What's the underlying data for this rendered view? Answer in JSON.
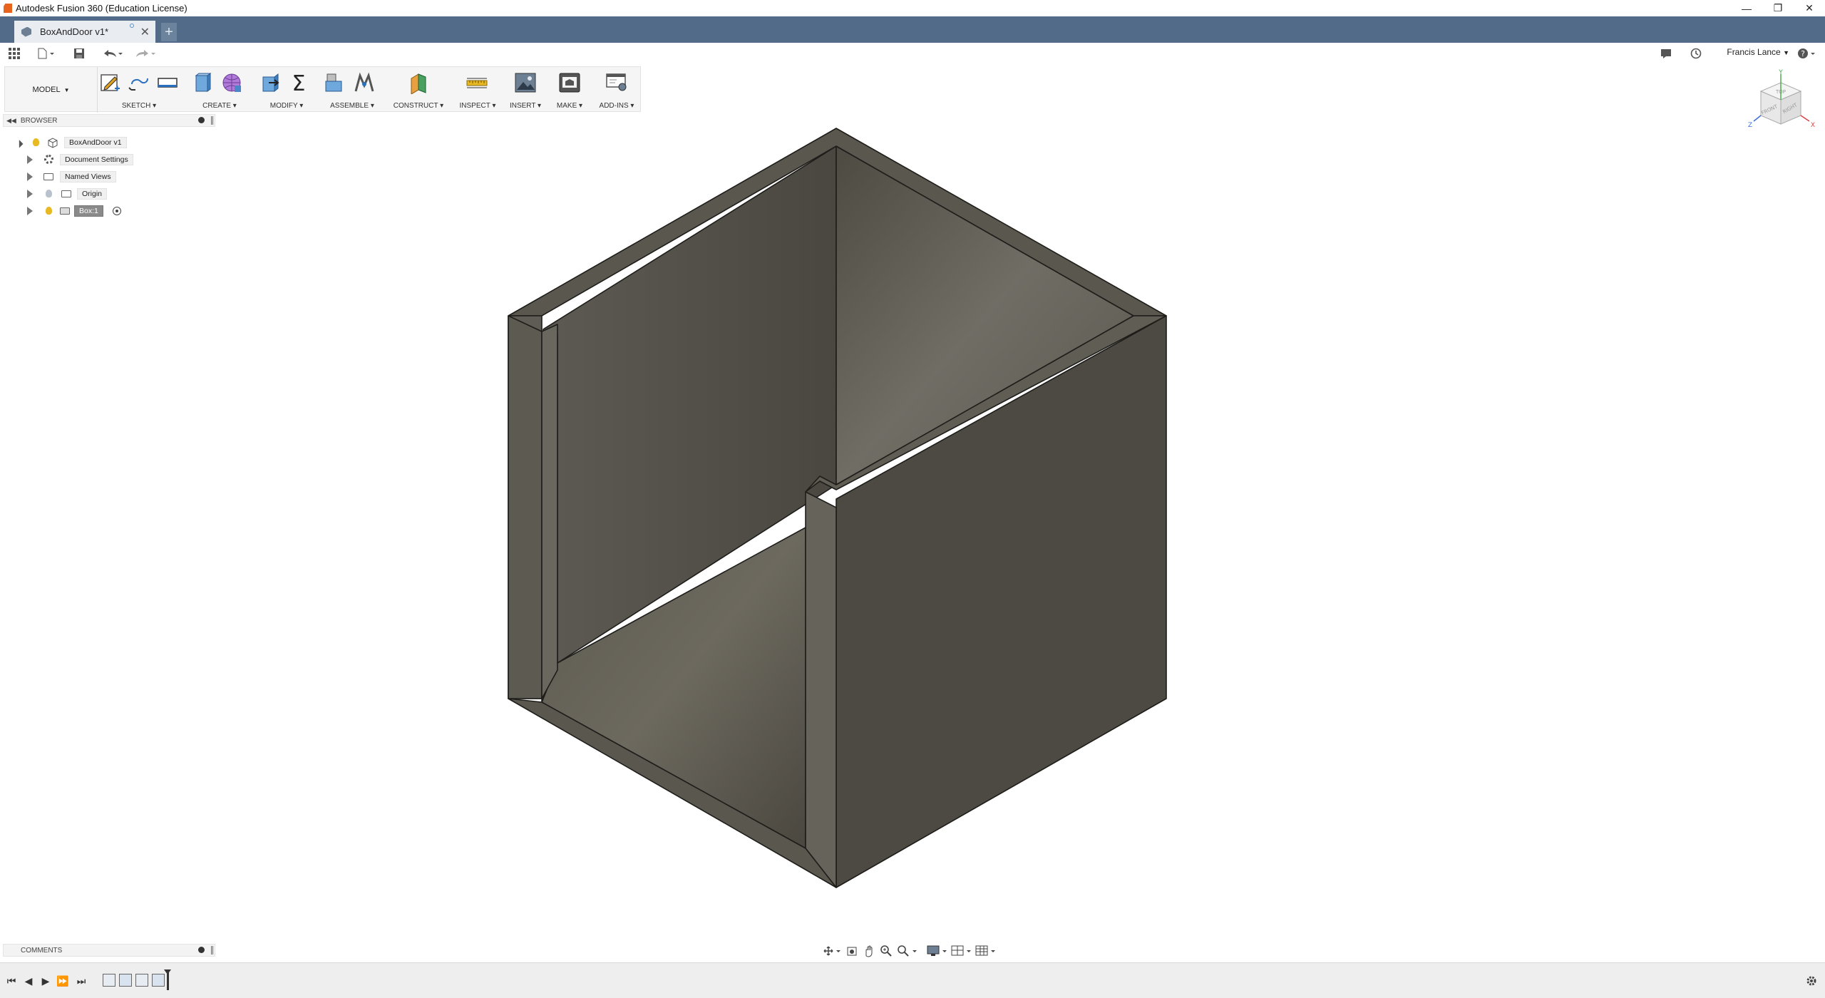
{
  "window": {
    "title": "Autodesk Fusion 360 (Education License)",
    "controls": [
      "minimize",
      "restore",
      "close"
    ]
  },
  "tabs": {
    "active": "BoxAndDoor v1*",
    "new_tab": "+"
  },
  "quick_access": {
    "user": "Francis Lance",
    "help": "?"
  },
  "toolbar": {
    "workspace": "MODEL",
    "groups": [
      {
        "label": "SKETCH",
        "icons": [
          "create-sketch-icon",
          "line-icon",
          "rectangle-icon"
        ]
      },
      {
        "label": "CREATE",
        "icons": [
          "box-icon",
          "form-icon"
        ]
      },
      {
        "label": "MODIFY",
        "icons": [
          "press-pull-icon",
          "parameters-icon"
        ]
      },
      {
        "label": "ASSEMBLE",
        "icons": [
          "new-component-icon",
          "joint-icon"
        ]
      },
      {
        "label": "CONSTRUCT",
        "icons": [
          "offset-plane-icon"
        ]
      },
      {
        "label": "INSPECT",
        "icons": [
          "measure-icon"
        ]
      },
      {
        "label": "INSERT",
        "icons": [
          "insert-image-icon"
        ]
      },
      {
        "label": "MAKE",
        "icons": [
          "make-icon"
        ]
      },
      {
        "label": "ADD-INS",
        "icons": [
          "scripts-icon"
        ]
      }
    ]
  },
  "browser": {
    "title": "BROWSER",
    "root": "BoxAndDoor v1",
    "items": [
      {
        "label": "Document Settings",
        "icon": "gear-icon"
      },
      {
        "label": "Named Views",
        "icon": "folder-icon"
      },
      {
        "label": "Origin",
        "icon": "folder-icon"
      },
      {
        "label": "Box:1",
        "icon": "component-icon",
        "selected": true
      }
    ]
  },
  "comments": {
    "title": "COMMENTS"
  },
  "viewcube": {
    "faces": [
      "TOP",
      "FRONT",
      "RIGHT"
    ],
    "axes": [
      "Y",
      "Z",
      "X"
    ]
  },
  "colors": {
    "tabbar": "#516b88",
    "model_dark": "#4d4a43",
    "model_mid": "#5b5850",
    "model_light": "#6b6960"
  }
}
